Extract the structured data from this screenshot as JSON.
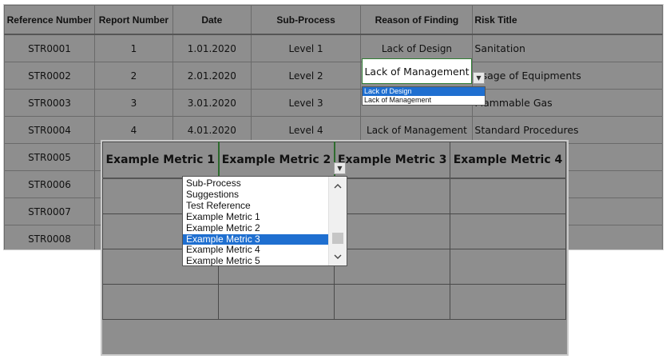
{
  "main_table": {
    "headers": [
      "Reference Number",
      "Report Number",
      "Date",
      "Sub-Process",
      "Reason of Finding",
      "Risk Title"
    ],
    "rows": [
      [
        "STR0001",
        "1",
        "1.01.2020",
        "Level 1",
        "Lack of Design",
        "Sanitation"
      ],
      [
        "STR0002",
        "2",
        "2.01.2020",
        "Level 2",
        "",
        "Usage of Equipments"
      ],
      [
        "STR0003",
        "3",
        "3.01.2020",
        "Level 3",
        "",
        "Flammable Gas"
      ],
      [
        "STR0004",
        "4",
        "4.01.2020",
        "Level 4",
        "Lack of Management",
        "Standard Procedures"
      ],
      [
        "STR0005",
        "",
        "",
        "",
        "",
        ""
      ],
      [
        "STR0006",
        "",
        "",
        "",
        "",
        ""
      ],
      [
        "STR0007",
        "",
        "",
        "",
        "",
        ""
      ],
      [
        "STR0008",
        "",
        "",
        "",
        "",
        ""
      ]
    ],
    "selected_cell_value": "Lack of Management",
    "dropdown_options": [
      "Lack of Design",
      "Lack of Management"
    ],
    "dropdown_highlighted": "Lack of Design",
    "dropdown_arrow_icon": "dropdown-arrow-icon"
  },
  "metric_panel": {
    "headers": [
      "Example Metric 1",
      "Example Metric 2",
      "Example Metric 3",
      "Example Metric 4"
    ],
    "dropdown_options": [
      "Sub-Process",
      "Suggestions",
      "Test Reference",
      "Example Metric 1",
      "Example Metric 2",
      "Example Metric 3",
      "Example Metric 4",
      "Example Metric 5"
    ],
    "dropdown_highlighted": "Example Metric 3",
    "scroll_up_icon": "chevron-up-icon",
    "scroll_down_icon": "chevron-down-icon"
  },
  "colors": {
    "sheet_bg": "#8e8e8e",
    "selection_blue": "#1f6fd0",
    "active_cell_border": "#2e7d32"
  }
}
